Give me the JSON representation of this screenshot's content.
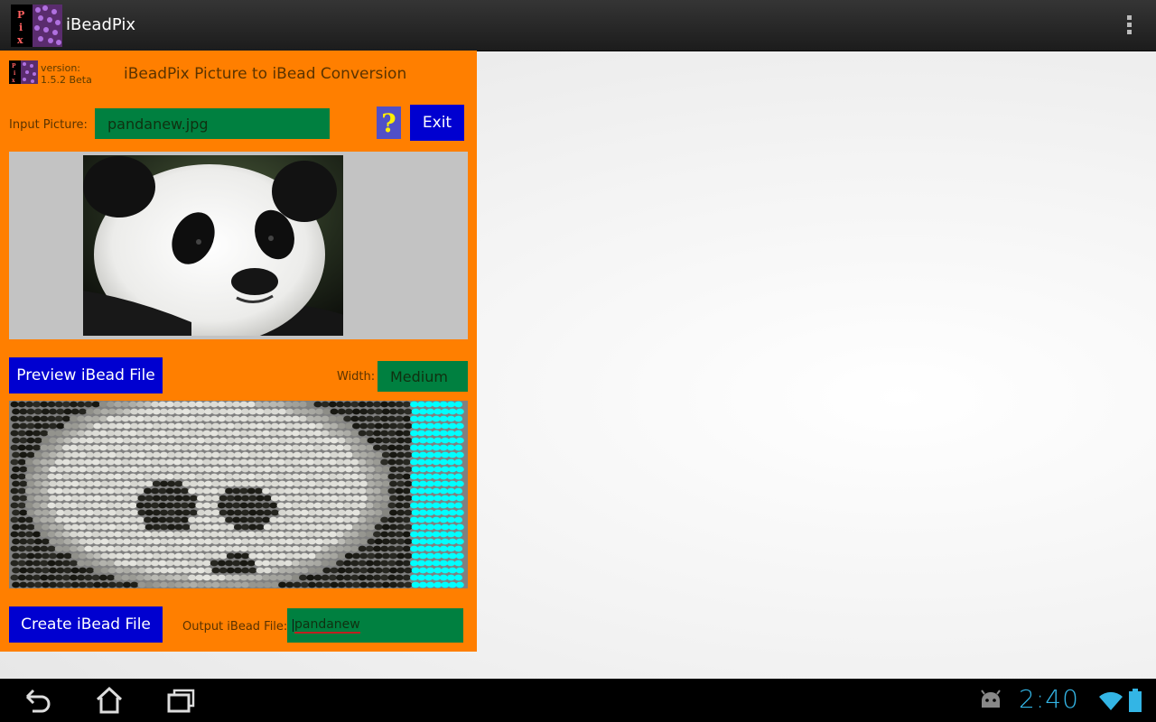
{
  "app": {
    "title": "iBeadPix",
    "icon_letters": [
      "P",
      "i",
      "x"
    ]
  },
  "actionbar": {
    "overflow_icon": "overflow-menu-icon"
  },
  "panel": {
    "version_label": "version:",
    "version_value": "1.5.2 Beta",
    "heading": "iBeadPix Picture to iBead Conversion",
    "input_label": "Input Picture:",
    "input_value": "pandanew.jpg",
    "help_label": "?",
    "exit_label": "Exit",
    "preview_label": "Preview iBead File",
    "width_label": "Width:",
    "width_value": "Medium",
    "create_label": "Create iBead File",
    "output_label": "Output iBead File:",
    "output_value": "pandanew"
  },
  "colors": {
    "panel": "#ff7f00",
    "button": "#0000d0",
    "field": "#008040",
    "bead_pad": "#00ffff"
  },
  "navbar": {
    "icons": [
      "back-icon",
      "home-icon",
      "recent-apps-icon",
      "android-debug-icon",
      "wifi-icon",
      "battery-icon"
    ],
    "clock": "2:40"
  }
}
